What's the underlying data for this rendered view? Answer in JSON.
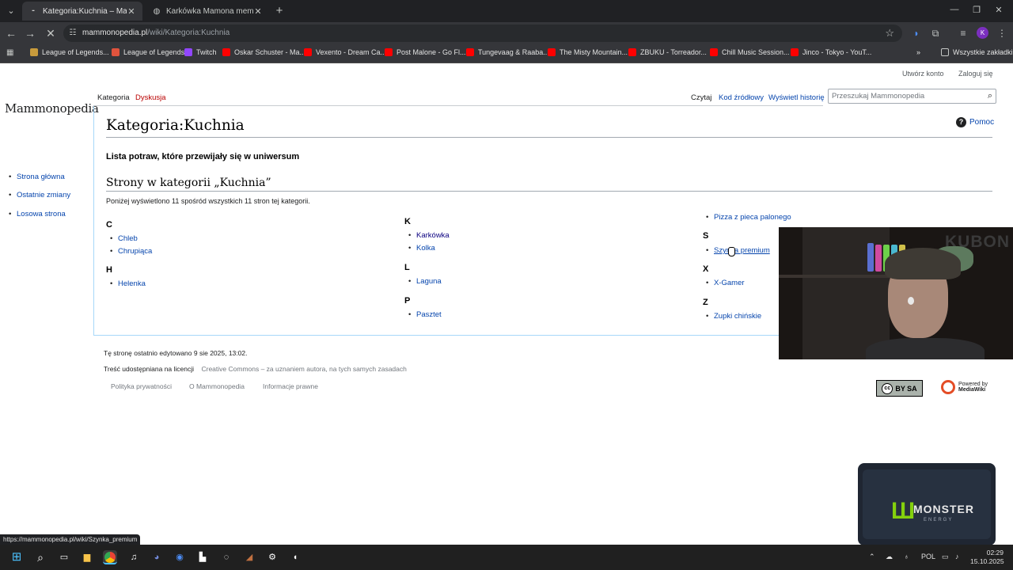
{
  "browser": {
    "tabs": [
      {
        "title": "Kategoria:Kuchnia – Mammono",
        "active": true
      },
      {
        "title": "Karkówka Mamona meme",
        "active": false
      }
    ],
    "url_host": "mammonopedia.pl",
    "url_path": "/wiki/Kategoria:Kuchnia",
    "profile_initial": "K",
    "bookmarks": [
      {
        "label": "League of Legends...",
        "color": "#c89b3c"
      },
      {
        "label": "League of Legends",
        "color": "#e0533d"
      },
      {
        "label": "Twitch",
        "color": "#9146ff"
      },
      {
        "label": "Oskar Schuster - Ma...",
        "color": "#ff0000"
      },
      {
        "label": "Vexento - Dream Ca...",
        "color": "#ff0000"
      },
      {
        "label": "Post Malone - Go Fl...",
        "color": "#ff0000"
      },
      {
        "label": "Tungevaag & Raaba...",
        "color": "#ff0000"
      },
      {
        "label": "The Misty Mountain...",
        "color": "#ff0000"
      },
      {
        "label": "ZBUKU - Torreador...",
        "color": "#ff0000"
      },
      {
        "label": "Chill Music Session...",
        "color": "#ff0000"
      },
      {
        "label": "Jinco - Tokyo - YouT...",
        "color": "#ff0000"
      }
    ],
    "all_bookmarks": "Wszystkie zakładki",
    "status_url": "https://mammonopedia.pl/wiki/Szynka_premium"
  },
  "wiki": {
    "logo": "Mammonopedia",
    "user_links": {
      "create_account": "Utwórz konto",
      "login": "Zaloguj się"
    },
    "namespace_tabs": {
      "category": "Kategoria",
      "talk": "Dyskusja"
    },
    "view_tabs": {
      "read": "Czytaj",
      "source": "Kod źródłowy",
      "history": "Wyświetl historię"
    },
    "search_placeholder": "Przeszukaj Mammonopedia",
    "sidebar": [
      "Strona główna",
      "Ostatnie zmiany",
      "Losowa strona"
    ],
    "title": "Kategoria:Kuchnia",
    "help": "Pomoc",
    "description": "Lista potraw, które przewijały się w uniwersum",
    "pages_heading": "Strony w kategorii „Kuchnia”",
    "count_text": "Poniżej wyświetlono 11 spośród wszystkich 11 stron tej kategorii.",
    "groups": {
      "C": [
        "Chleb",
        "Chrupiąca"
      ],
      "H": [
        "Helenka"
      ],
      "K": [
        "Karkówka",
        "Kolka"
      ],
      "L": [
        "Laguna"
      ],
      "P": [
        "Pasztet",
        "Pizza z pieca palonego"
      ],
      "S": [
        "Szynka premium"
      ],
      "X": [
        "X-Gamer"
      ],
      "Z": [
        "Zupki chińskie"
      ]
    },
    "footer": {
      "last_edit": "Tę stronę ostatnio edytowano 9 sie 2025, 13:02.",
      "license_prefix": "Treść udostępniana na licencji",
      "license_link": "Creative Commons – za uznaniem autora, na tych samych zasadach",
      "links": [
        "Polityka prywatności",
        "O Mammonopedia",
        "Informacje prawne"
      ],
      "cc_badge": "BY SA",
      "powered_by": [
        "Powered by",
        "MediaWiki"
      ]
    }
  },
  "overlays": {
    "webcam_text": "KUBON",
    "sponsor": "MONSTER",
    "sponsor_sub": "ENERGY"
  },
  "taskbar": {
    "lang": "POL",
    "time": "02:29",
    "date": "15.10.2025"
  }
}
